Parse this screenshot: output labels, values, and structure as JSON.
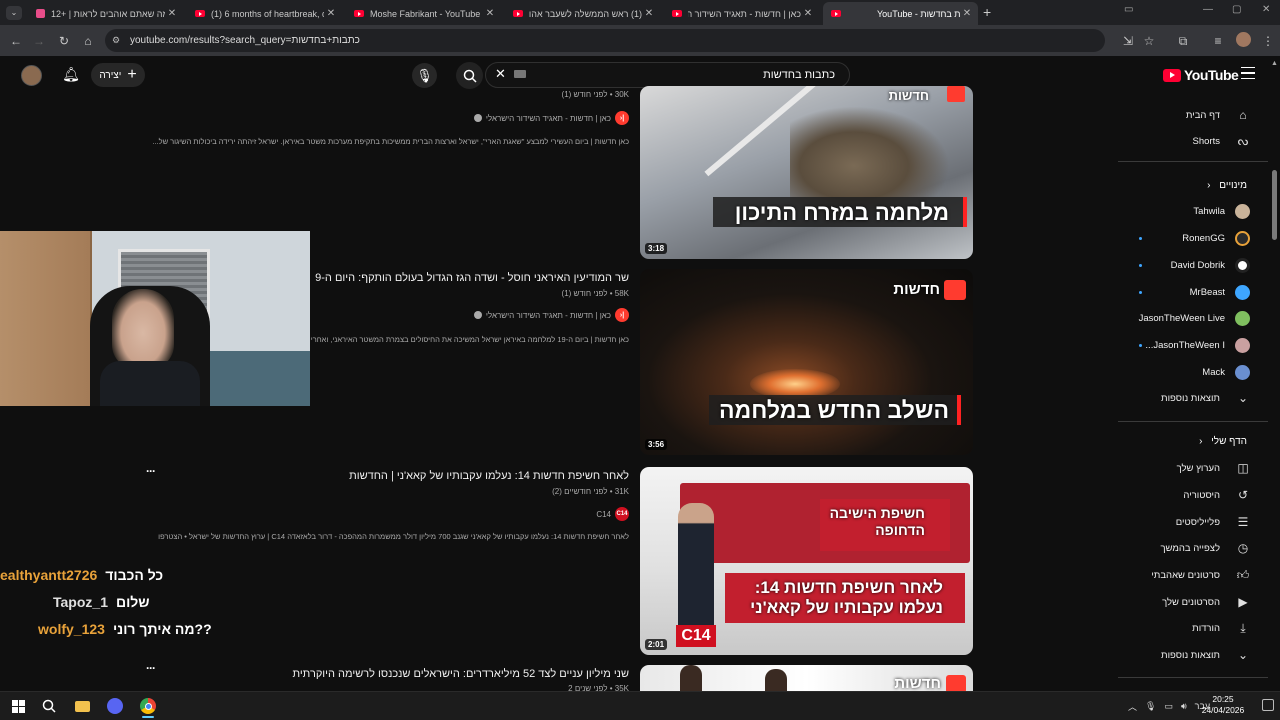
{
  "browser": {
    "tabs": [
      {
        "title": "12+ | מה שאתם אוהבים לראות",
        "active": false
      },
      {
        "title": "(1) 6 months of heartbreak, do",
        "active": false
      },
      {
        "title": "Moshe Fabrikant - YouTube",
        "active": false
      },
      {
        "title": "(1) ראש הממשלה לשעבר אהוד",
        "active": false
      },
      {
        "title": "כאן | חדשות - תאגיד השידור ה",
        "active": false
      },
      {
        "title": "YouTube - כתבות בחדשות",
        "active": true
      }
    ],
    "url": "youtube.com/results?search_query=כתבות+בחדשות"
  },
  "youtube": {
    "logo_text": "YouTube",
    "search_query": "כתבות בחדשות",
    "create_label": "יצירה"
  },
  "sidebar": {
    "main": [
      {
        "label": "דף הבית",
        "icon": "home-icon"
      },
      {
        "label": "Shorts",
        "icon": "shorts-icon"
      }
    ],
    "subscriptions_header": "מינויים",
    "subscriptions": [
      {
        "label": "Tahwila",
        "color": "#c9b39a",
        "dot": false
      },
      {
        "label": "RonenGG",
        "color": "#e8a23a",
        "dot": true
      },
      {
        "label": "David Dobrik",
        "color": "#ffffff",
        "dot": true
      },
      {
        "label": "MrBeast",
        "color": "#3ea6ff",
        "dot": true
      },
      {
        "label": "JasonTheWeen Live",
        "color": "#7fbf5f",
        "dot": false
      },
      {
        "label": "JasonTheWeen I...",
        "color": "#c9a0a0",
        "dot": true
      },
      {
        "label": "Mack",
        "color": "#6a8fd0",
        "dot": false
      }
    ],
    "show_more_1": "תוצאות נוספות",
    "you_header": "הדף שלי",
    "you": [
      {
        "label": "הערוץ שלך",
        "icon": "your-channel-icon"
      },
      {
        "label": "היסטוריה",
        "icon": "history-icon"
      },
      {
        "label": "פלייליסטים",
        "icon": "playlists-icon"
      },
      {
        "label": "לצפייה בהמשך",
        "icon": "watch-later-icon"
      },
      {
        "label": "סרטונים שאהבתי",
        "icon": "liked-icon"
      },
      {
        "label": "הסרטונים שלך",
        "icon": "your-videos-icon"
      },
      {
        "label": "הורדות",
        "icon": "downloads-icon"
      }
    ],
    "show_more_2": "תוצאות נוספות"
  },
  "results": [
    {
      "meta": "30K • לפני חודש (1)",
      "channel": "כאן | חדשות - תאגיד השידור הישראלי",
      "verified": true,
      "description": "כאן חדשות | ביום העשירי למבצע \"שאגת הארי\", ישראל וארצות הברית ממשיכות בתקיפת מערכות משטר באיראן. ישראל זיהתה ירידה ביכולות השיגור של...",
      "duration": "3:18",
      "overlay": "מלחמה במזרח התיכון",
      "brand": "חדשות"
    },
    {
      "title": "שר המודיעין האיראני חוסל - ושדה הגז הגדול בעולם הותקף: היום ה-9",
      "meta": "58K • לפני חודש (1)",
      "channel": "כאן | חדשות - תאגיד השידור הישראלי",
      "verified": true,
      "description": "כאן חדשות | ביום ה-19 למלחמה באיראן ישראל המשיכה את החיסולים בצמרת המשטר האיראני, ואחרי ה...",
      "duration": "3:56",
      "overlay": "השלב החדש במלחמה",
      "brand": "חדשות"
    },
    {
      "title": "לאחר חשיפת חדשות 14: נעלמו עקבותיו של קאא'ני | החדשות",
      "meta": "31K • לפני חודשיים (2)",
      "channel": "C14",
      "verified": false,
      "description": "לאחר חשיפת חדשות 14: נעלמו עקבותיו של קאא'ני שגנב 700 מיליון דולר ממשמרות המהפכה - דרור בלאזאדה C14 | ערוץ החדשות של ישראל • הצטרפו",
      "duration": "2:01",
      "overlay_top": "חשיפת הישיבה הדחופה",
      "overlay_bottom_1": "לאחר חשיפת חדשות 14:",
      "overlay_bottom_2": "נעלמו עקבותיו של קאא'ני",
      "brand": "C14"
    },
    {
      "title": "שני מיליון עניים לצד 52 מיליארדרים: הישראלים שנכנסו לרשימה היוקרתית",
      "meta": "35K • לפני שנים 2",
      "brand": "חדשות"
    }
  ],
  "chat": [
    {
      "user": "ealthyantt2726",
      "message": "כל הכבוד"
    },
    {
      "user": "Tapoz_1",
      "message": "שלום"
    },
    {
      "user": "wolfy_123",
      "message": "מה איתך רוני??"
    }
  ],
  "taskbar": {
    "language": "עבר",
    "time": "20:25",
    "date": "24/04/2026"
  }
}
